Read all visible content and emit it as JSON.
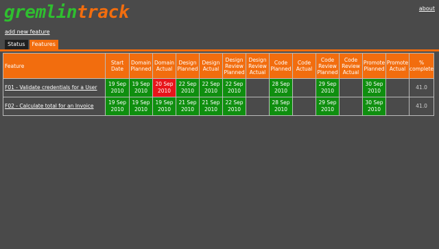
{
  "brand": {
    "part1": "gremlin",
    "part2": "track"
  },
  "header": {
    "about_label": "about"
  },
  "links": {
    "add_feature": "add new feature"
  },
  "tabs": [
    {
      "label": "Status",
      "active": false
    },
    {
      "label": "Features",
      "active": true
    }
  ],
  "table": {
    "columns": [
      "Feature",
      "Start Date",
      "Domain Planned",
      "Domain Actual",
      "Design Planned",
      "Design Actual",
      "Design Review Planned",
      "Design Review Actual",
      "Code Planned",
      "Code Actual",
      "Code Review Planned",
      "Code Review Actual",
      "Promote Planned",
      "Promote Actual",
      "% complete"
    ],
    "rows": [
      {
        "feature": "F01 - Validate credentials for a User",
        "cells": [
          {
            "text": "19 Sep 2010",
            "status": "green"
          },
          {
            "text": "19 Sep 2010",
            "status": "green"
          },
          {
            "text": "20 Sep 2010",
            "status": "red"
          },
          {
            "text": "22 Sep 2010",
            "status": "green"
          },
          {
            "text": "22 Sep 2010",
            "status": "green"
          },
          {
            "text": "22 Sep 2010",
            "status": "green"
          },
          {
            "text": "",
            "status": "empty"
          },
          {
            "text": "28 Sep 2010",
            "status": "green"
          },
          {
            "text": "",
            "status": "empty"
          },
          {
            "text": "29 Sep 2010",
            "status": "green"
          },
          {
            "text": "",
            "status": "empty"
          },
          {
            "text": "30 Sep 2010",
            "status": "green"
          },
          {
            "text": "",
            "status": "empty"
          },
          {
            "text": "41.0",
            "status": "pct"
          }
        ]
      },
      {
        "feature": "F02 - Calculate total for an Invoice",
        "cells": [
          {
            "text": "19 Sep 2010",
            "status": "green"
          },
          {
            "text": "19 Sep 2010",
            "status": "green"
          },
          {
            "text": "19 Sep 2010",
            "status": "green"
          },
          {
            "text": "21 Sep 2010",
            "status": "green"
          },
          {
            "text": "21 Sep 2010",
            "status": "green"
          },
          {
            "text": "22 Sep 2010",
            "status": "green"
          },
          {
            "text": "",
            "status": "empty"
          },
          {
            "text": "28 Sep 2010",
            "status": "green"
          },
          {
            "text": "",
            "status": "empty"
          },
          {
            "text": "29 Sep 2010",
            "status": "green"
          },
          {
            "text": "",
            "status": "empty"
          },
          {
            "text": "30 Sep 2010",
            "status": "green"
          },
          {
            "text": "",
            "status": "empty"
          },
          {
            "text": "41.0",
            "status": "pct"
          }
        ]
      }
    ]
  },
  "colors": {
    "accent": "#f26d0e",
    "green": "#0f8f0f",
    "red": "#e8141a",
    "background": "#4a4a4a"
  }
}
